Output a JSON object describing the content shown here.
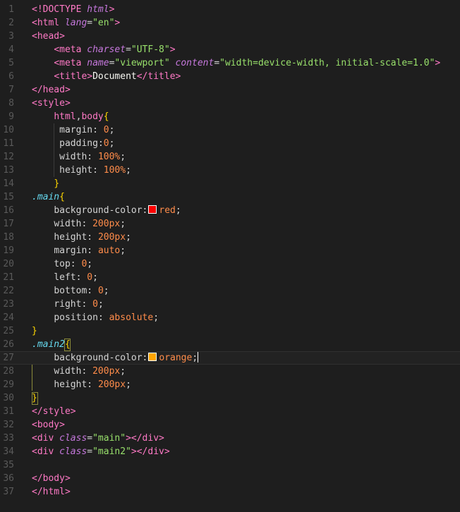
{
  "editor": {
    "colors": {
      "background": "#1e1e1e",
      "red_swatch": "#ff0000",
      "orange_swatch": "#ffa500"
    },
    "lines": [
      {
        "n": "1",
        "tokens": [
          [
            "t-tag",
            "<!DOCTYPE "
          ],
          [
            "t-attr",
            "html"
          ],
          [
            "t-tag",
            ">"
          ]
        ]
      },
      {
        "n": "2",
        "tokens": [
          [
            "t-tag",
            "<html "
          ],
          [
            "t-attr",
            "lang"
          ],
          [
            "t-punc",
            "="
          ],
          [
            "t-str",
            "\"en\""
          ],
          [
            "t-tag",
            ">"
          ]
        ]
      },
      {
        "n": "3",
        "tokens": [
          [
            "t-tag",
            "<head>"
          ]
        ]
      },
      {
        "n": "4",
        "tokens": [
          [
            "t-punc",
            "    "
          ],
          [
            "t-tag",
            "<meta "
          ],
          [
            "t-attr",
            "charset"
          ],
          [
            "t-punc",
            "="
          ],
          [
            "t-str",
            "\"UTF-8\""
          ],
          [
            "t-tag",
            ">"
          ]
        ]
      },
      {
        "n": "5",
        "tokens": [
          [
            "t-punc",
            "    "
          ],
          [
            "t-tag",
            "<meta "
          ],
          [
            "t-attr",
            "name"
          ],
          [
            "t-punc",
            "="
          ],
          [
            "t-str",
            "\"viewport\""
          ],
          [
            "t-punc",
            " "
          ],
          [
            "t-attr",
            "content"
          ],
          [
            "t-punc",
            "="
          ],
          [
            "t-str",
            "\"width=device-width, initial-scale=1.0\""
          ],
          [
            "t-tag",
            ">"
          ]
        ]
      },
      {
        "n": "6",
        "tokens": [
          [
            "t-punc",
            "    "
          ],
          [
            "t-tag",
            "<title>"
          ],
          [
            "t-text",
            "Document"
          ],
          [
            "t-tag",
            "</title>"
          ]
        ]
      },
      {
        "n": "7",
        "tokens": [
          [
            "t-tag",
            "</head>"
          ]
        ]
      },
      {
        "n": "8",
        "tokens": [
          [
            "t-tag",
            "<style>"
          ]
        ]
      },
      {
        "n": "9",
        "tokens": [
          [
            "t-punc",
            "    "
          ],
          [
            "t-sel",
            "html"
          ],
          [
            "t-punc",
            ","
          ],
          [
            "t-sel",
            "body"
          ],
          [
            "t-brace",
            "{"
          ]
        ]
      },
      {
        "n": "10",
        "tokens": [
          [
            "t-punc",
            "     "
          ],
          [
            "t-prop",
            "margin"
          ],
          [
            "t-punc",
            ": "
          ],
          [
            "t-num",
            "0"
          ],
          [
            "t-punc",
            ";"
          ]
        ]
      },
      {
        "n": "11",
        "tokens": [
          [
            "t-punc",
            "     "
          ],
          [
            "t-prop",
            "padding"
          ],
          [
            "t-punc",
            ":"
          ],
          [
            "t-num",
            "0"
          ],
          [
            "t-punc",
            ";"
          ]
        ]
      },
      {
        "n": "12",
        "tokens": [
          [
            "t-punc",
            "     "
          ],
          [
            "t-prop",
            "width"
          ],
          [
            "t-punc",
            ": "
          ],
          [
            "t-num",
            "100%"
          ],
          [
            "t-punc",
            ";"
          ]
        ]
      },
      {
        "n": "13",
        "tokens": [
          [
            "t-punc",
            "     "
          ],
          [
            "t-prop",
            "height"
          ],
          [
            "t-punc",
            ": "
          ],
          [
            "t-num",
            "100%"
          ],
          [
            "t-punc",
            ";"
          ]
        ]
      },
      {
        "n": "14",
        "tokens": [
          [
            "t-punc",
            "    "
          ],
          [
            "t-brace",
            "}"
          ]
        ]
      },
      {
        "n": "15",
        "tokens": [
          [
            "t-cls",
            ".main"
          ],
          [
            "t-brace",
            "{"
          ]
        ]
      },
      {
        "n": "16",
        "tokens": [
          [
            "t-punc",
            "    "
          ],
          [
            "t-prop",
            "background-color"
          ],
          [
            "t-punc",
            ":"
          ],
          [
            "swatch-red",
            ""
          ],
          [
            "t-kw",
            "red"
          ],
          [
            "t-punc",
            ";"
          ]
        ]
      },
      {
        "n": "17",
        "tokens": [
          [
            "t-punc",
            "    "
          ],
          [
            "t-prop",
            "width"
          ],
          [
            "t-punc",
            ": "
          ],
          [
            "t-num",
            "200px"
          ],
          [
            "t-punc",
            ";"
          ]
        ]
      },
      {
        "n": "18",
        "tokens": [
          [
            "t-punc",
            "    "
          ],
          [
            "t-prop",
            "height"
          ],
          [
            "t-punc",
            ": "
          ],
          [
            "t-num",
            "200px"
          ],
          [
            "t-punc",
            ";"
          ]
        ]
      },
      {
        "n": "19",
        "tokens": [
          [
            "t-punc",
            "    "
          ],
          [
            "t-prop",
            "margin"
          ],
          [
            "t-punc",
            ": "
          ],
          [
            "t-kw",
            "auto"
          ],
          [
            "t-punc",
            ";"
          ]
        ]
      },
      {
        "n": "20",
        "tokens": [
          [
            "t-punc",
            "    "
          ],
          [
            "t-prop",
            "top"
          ],
          [
            "t-punc",
            ": "
          ],
          [
            "t-num",
            "0"
          ],
          [
            "t-punc",
            ";"
          ]
        ]
      },
      {
        "n": "21",
        "tokens": [
          [
            "t-punc",
            "    "
          ],
          [
            "t-prop",
            "left"
          ],
          [
            "t-punc",
            ": "
          ],
          [
            "t-num",
            "0"
          ],
          [
            "t-punc",
            ";"
          ]
        ]
      },
      {
        "n": "22",
        "tokens": [
          [
            "t-punc",
            "    "
          ],
          [
            "t-prop",
            "bottom"
          ],
          [
            "t-punc",
            ": "
          ],
          [
            "t-num",
            "0"
          ],
          [
            "t-punc",
            ";"
          ]
        ]
      },
      {
        "n": "23",
        "tokens": [
          [
            "t-punc",
            "    "
          ],
          [
            "t-prop",
            "right"
          ],
          [
            "t-punc",
            ": "
          ],
          [
            "t-num",
            "0"
          ],
          [
            "t-punc",
            ";"
          ]
        ]
      },
      {
        "n": "24",
        "tokens": [
          [
            "t-punc",
            "    "
          ],
          [
            "t-prop",
            "position"
          ],
          [
            "t-punc",
            ": "
          ],
          [
            "t-kw",
            "absolute"
          ],
          [
            "t-punc",
            ";"
          ]
        ]
      },
      {
        "n": "25",
        "tokens": [
          [
            "t-brace",
            "}"
          ]
        ]
      },
      {
        "n": "26",
        "tokens": [
          [
            "t-cls",
            ".main2"
          ],
          [
            "t-brace",
            "{"
          ]
        ]
      },
      {
        "n": "27",
        "current": true,
        "tokens": [
          [
            "t-punc",
            "    "
          ],
          [
            "t-prop",
            "background-color"
          ],
          [
            "t-punc",
            ":"
          ],
          [
            "swatch-orange",
            ""
          ],
          [
            "t-kw",
            "orange"
          ],
          [
            "t-punc",
            ";"
          ],
          [
            "cursor",
            ""
          ]
        ]
      },
      {
        "n": "28",
        "tokens": [
          [
            "t-punc",
            "    "
          ],
          [
            "t-prop",
            "width"
          ],
          [
            "t-punc",
            ": "
          ],
          [
            "t-num",
            "200px"
          ],
          [
            "t-punc",
            ";"
          ]
        ]
      },
      {
        "n": "29",
        "tokens": [
          [
            "t-punc",
            "    "
          ],
          [
            "t-prop",
            "height"
          ],
          [
            "t-punc",
            ": "
          ],
          [
            "t-num",
            "200px"
          ],
          [
            "t-punc",
            ";"
          ]
        ]
      },
      {
        "n": "30",
        "tokens": [
          [
            "t-brace",
            "}"
          ]
        ]
      },
      {
        "n": "31",
        "tokens": [
          [
            "t-tag",
            "</style>"
          ]
        ]
      },
      {
        "n": "32",
        "tokens": [
          [
            "t-tag",
            "<body>"
          ]
        ]
      },
      {
        "n": "33",
        "tokens": [
          [
            "t-tag",
            "<div "
          ],
          [
            "t-attr",
            "class"
          ],
          [
            "t-punc",
            "="
          ],
          [
            "t-str",
            "\"main\""
          ],
          [
            "t-tag",
            "></div>"
          ]
        ]
      },
      {
        "n": "34",
        "tokens": [
          [
            "t-tag",
            "<div "
          ],
          [
            "t-attr",
            "class"
          ],
          [
            "t-punc",
            "="
          ],
          [
            "t-str",
            "\"main2\""
          ],
          [
            "t-tag",
            "></div>"
          ]
        ]
      },
      {
        "n": "35",
        "tokens": []
      },
      {
        "n": "36",
        "tokens": [
          [
            "t-tag",
            "</body>"
          ]
        ]
      },
      {
        "n": "37",
        "tokens": [
          [
            "t-tag",
            "</html>"
          ]
        ]
      }
    ]
  }
}
